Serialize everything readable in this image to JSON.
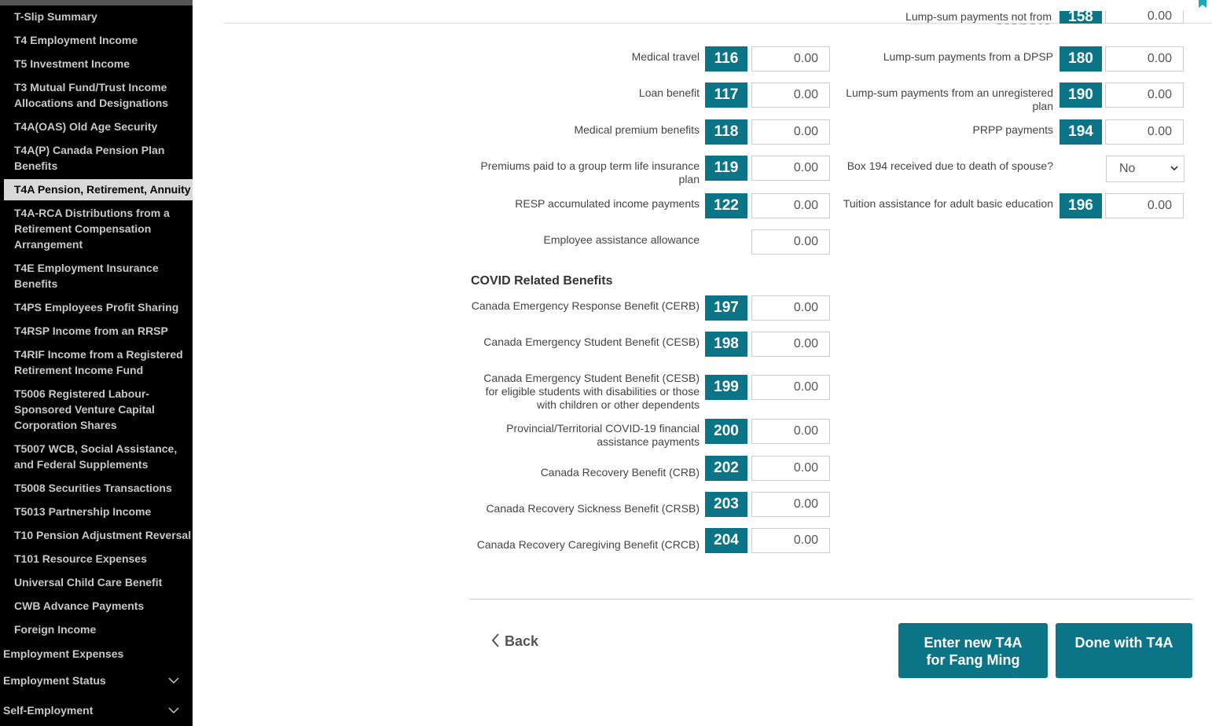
{
  "sidebar": {
    "items": [
      {
        "label": "T-Slip Summary"
      },
      {
        "label": "T4 Employment Income"
      },
      {
        "label": "T5 Investment Income"
      },
      {
        "label": "T3 Mutual Fund/Trust Income Allocations and Designations"
      },
      {
        "label": "T4A(OAS) Old Age Security"
      },
      {
        "label": "T4A(P) Canada Pension Plan Benefits"
      },
      {
        "label": "T4A Pension, Retirement, Annuity",
        "active": true
      },
      {
        "label": "T4A-RCA Distributions from a Retirement Compensation Arrangement"
      },
      {
        "label": "T4E Employment Insurance Benefits"
      },
      {
        "label": "T4PS Employees Profit Sharing"
      },
      {
        "label": "T4RSP Income from an RRSP"
      },
      {
        "label": "T4RIF Income from a Registered Retirement Income Fund"
      },
      {
        "label": "T5006 Registered Labour-Sponsored Venture Capital Corporation Shares"
      },
      {
        "label": "T5007 WCB, Social Assistance, and Federal Supplements"
      },
      {
        "label": "T5008 Securities Transactions"
      },
      {
        "label": "T5013 Partnership Income"
      },
      {
        "label": "T10 Pension Adjustment Reversal"
      },
      {
        "label": "T101 Resource Expenses"
      },
      {
        "label": "Universal Child Care Benefit"
      },
      {
        "label": "CWB Advance Payments"
      },
      {
        "label": "Foreign Income"
      }
    ],
    "sections": [
      {
        "label": "Employment Expenses"
      },
      {
        "label": "Employment Status",
        "chevron": "chevron-down-icon"
      },
      {
        "label": "Self-Employment",
        "chevron": "chevron-down-icon"
      }
    ]
  },
  "partial_row": {
    "label": "Lump-sum payments not from RPP/DPSP",
    "box": "158",
    "value": "0.00"
  },
  "left_fields": [
    {
      "label": "Medical travel",
      "box": "116",
      "value": "0.00"
    },
    {
      "label": "Loan benefit",
      "box": "117",
      "value": "0.00"
    },
    {
      "label": "Medical premium benefits",
      "box": "118",
      "value": "0.00"
    },
    {
      "label": "Premiums paid to a group term life insurance plan",
      "box": "119",
      "value": "0.00"
    },
    {
      "label": "RESP accumulated income payments",
      "box": "122",
      "value": "0.00"
    },
    {
      "label": "Employee assistance allowance",
      "box": "",
      "value": "0.00"
    }
  ],
  "right_fields": [
    {
      "label": "Lump-sum payments from a DPSP",
      "box": "180",
      "value": "0.00"
    },
    {
      "label": "Lump-sum payments from an unregistered plan",
      "box": "190",
      "value": "0.00"
    },
    {
      "label": "PRPP payments",
      "box": "194",
      "value": "0.00"
    },
    {
      "label": "Box 194 received due to death of spouse?",
      "box": "",
      "value": "No"
    },
    {
      "label": "Tuition assistance for adult basic education",
      "box": "196",
      "value": "0.00"
    }
  ],
  "covid": {
    "title": "COVID Related Benefits",
    "fields": [
      {
        "label": "Canada Emergency Response Benefit (CERB)",
        "box": "197",
        "value": "0.00"
      },
      {
        "label": "Canada Emergency Student Benefit (CESB)",
        "box": "198",
        "value": "0.00"
      },
      {
        "label": "Canada Emergency Student Benefit (CESB) for eligible students with disabilities or those with children or other dependents",
        "box": "199",
        "value": "0.00"
      },
      {
        "label": "Provincial/Territorial COVID-19 financial assistance payments",
        "box": "200",
        "value": "0.00"
      },
      {
        "label": "Canada Recovery Benefit (CRB)",
        "box": "202",
        "value": "0.00"
      },
      {
        "label": "Canada Recovery Sickness Benefit (CRSB)",
        "box": "203",
        "value": "0.00"
      },
      {
        "label": "Canada Recovery Caregiving Benefit (CRCB)",
        "box": "204",
        "value": "0.00"
      }
    ]
  },
  "footer": {
    "back_label": "Back",
    "enter_new_label": "Enter new T4A for Fang Ming",
    "done_label": "Done with T4A"
  },
  "colors": {
    "accent": "#0b7587",
    "sidebar_bg": "#000000",
    "active_item_bg": "#d9d9d9"
  }
}
